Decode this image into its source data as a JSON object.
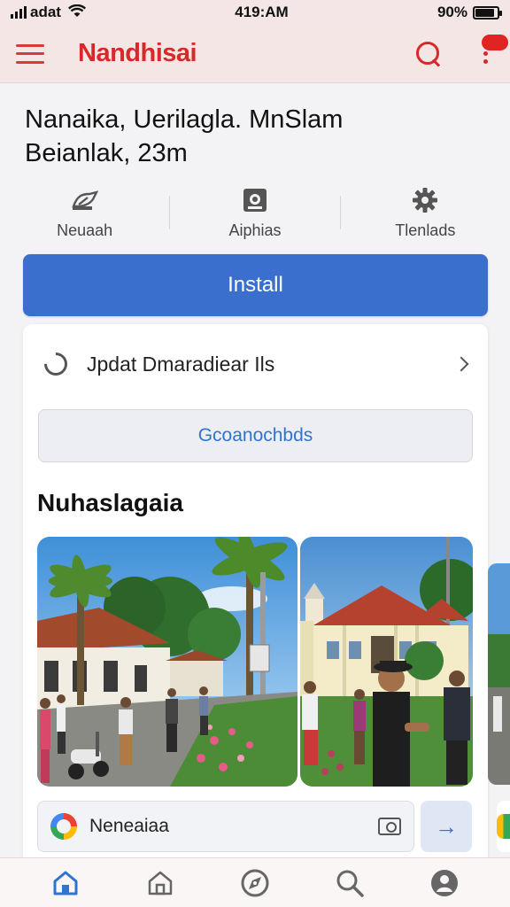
{
  "status_bar": {
    "carrier": "adat",
    "time": "419:AM",
    "battery_text": "90%",
    "battery_level": 0.8
  },
  "app_bar": {
    "title": "Nandhisai",
    "title_color": "#d62a2a",
    "icons": [
      "menu-icon",
      "search-icon",
      "more-vertical-icon"
    ]
  },
  "headline": {
    "line1": "Nanaika, Uerilagla. MnSlam",
    "line2": "Beianlak, 23m"
  },
  "quick_actions": [
    {
      "label": "Neuaah",
      "icon": "edit-icon"
    },
    {
      "label": "Aiphias",
      "icon": "camera-icon"
    },
    {
      "label": "Tlenlads",
      "icon": "gear-icon"
    }
  ],
  "install_button": {
    "label": "Install",
    "color": "#3a6fce"
  },
  "update_row": {
    "text": "Jpdat Dmaradiear Ils",
    "icon": "refresh-icon"
  },
  "secondary_button": {
    "label": "Gcoanochbds"
  },
  "section": {
    "title": "Nuhaslagaia"
  },
  "photos": [
    {
      "icon": "street-photo"
    },
    {
      "icon": "building-photo"
    }
  ],
  "search": {
    "text": "Neneaiaa",
    "icon": "google-icon"
  },
  "go_button": {
    "label": "→"
  },
  "bottom_nav": [
    {
      "icon": "home-icon",
      "active": true
    },
    {
      "icon": "home-outline-icon",
      "active": false
    },
    {
      "icon": "compass-icon",
      "active": false
    },
    {
      "icon": "search-icon",
      "active": false
    },
    {
      "icon": "profile-icon",
      "active": false
    }
  ]
}
